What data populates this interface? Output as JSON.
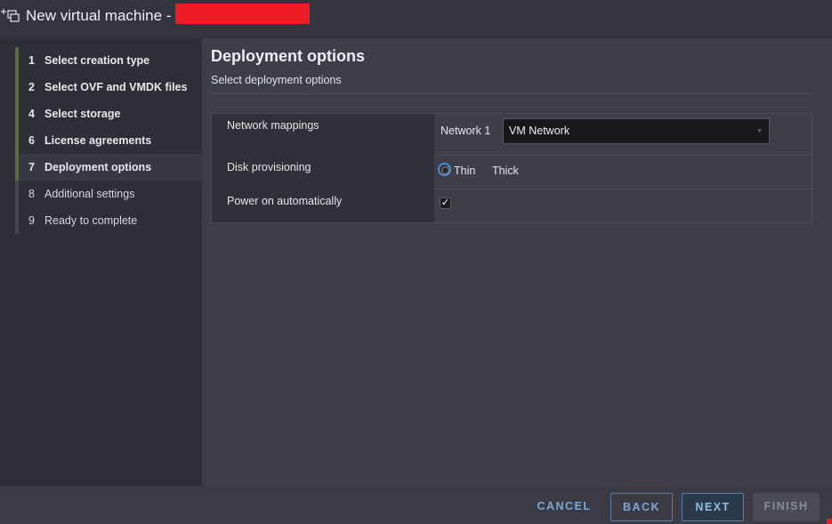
{
  "window": {
    "title": "New virtual machine -"
  },
  "sidebar": {
    "steps": [
      {
        "num": "1",
        "label": "Select creation type",
        "state": "done"
      },
      {
        "num": "2",
        "label": "Select OVF and VMDK files",
        "state": "done"
      },
      {
        "num": "4",
        "label": "Select storage",
        "state": "done"
      },
      {
        "num": "6",
        "label": "License agreements",
        "state": "done"
      },
      {
        "num": "7",
        "label": "Deployment options",
        "state": "active"
      },
      {
        "num": "8",
        "label": "Additional settings",
        "state": "pending"
      },
      {
        "num": "9",
        "label": "Ready to complete",
        "state": "pending"
      }
    ]
  },
  "main": {
    "heading": "Deployment options",
    "subheading": "Select deployment options",
    "options": {
      "network_mappings_label": "Network mappings",
      "network_name": "Network 1",
      "network_value": "VM Network",
      "disk_provisioning_label": "Disk provisioning",
      "disk_thin_label": "Thin",
      "disk_thick_label": "Thick",
      "power_on_label": "Power on automatically",
      "power_on_checked": true
    }
  },
  "footer": {
    "cancel_label": "CANCEL",
    "back_label": "BACK",
    "next_label": "NEXT",
    "finish_label": "FINISH"
  },
  "colors": {
    "accent_completed": "#5d6a3f",
    "link_blue": "#7aa8d6",
    "redaction": "#ed1c24"
  }
}
